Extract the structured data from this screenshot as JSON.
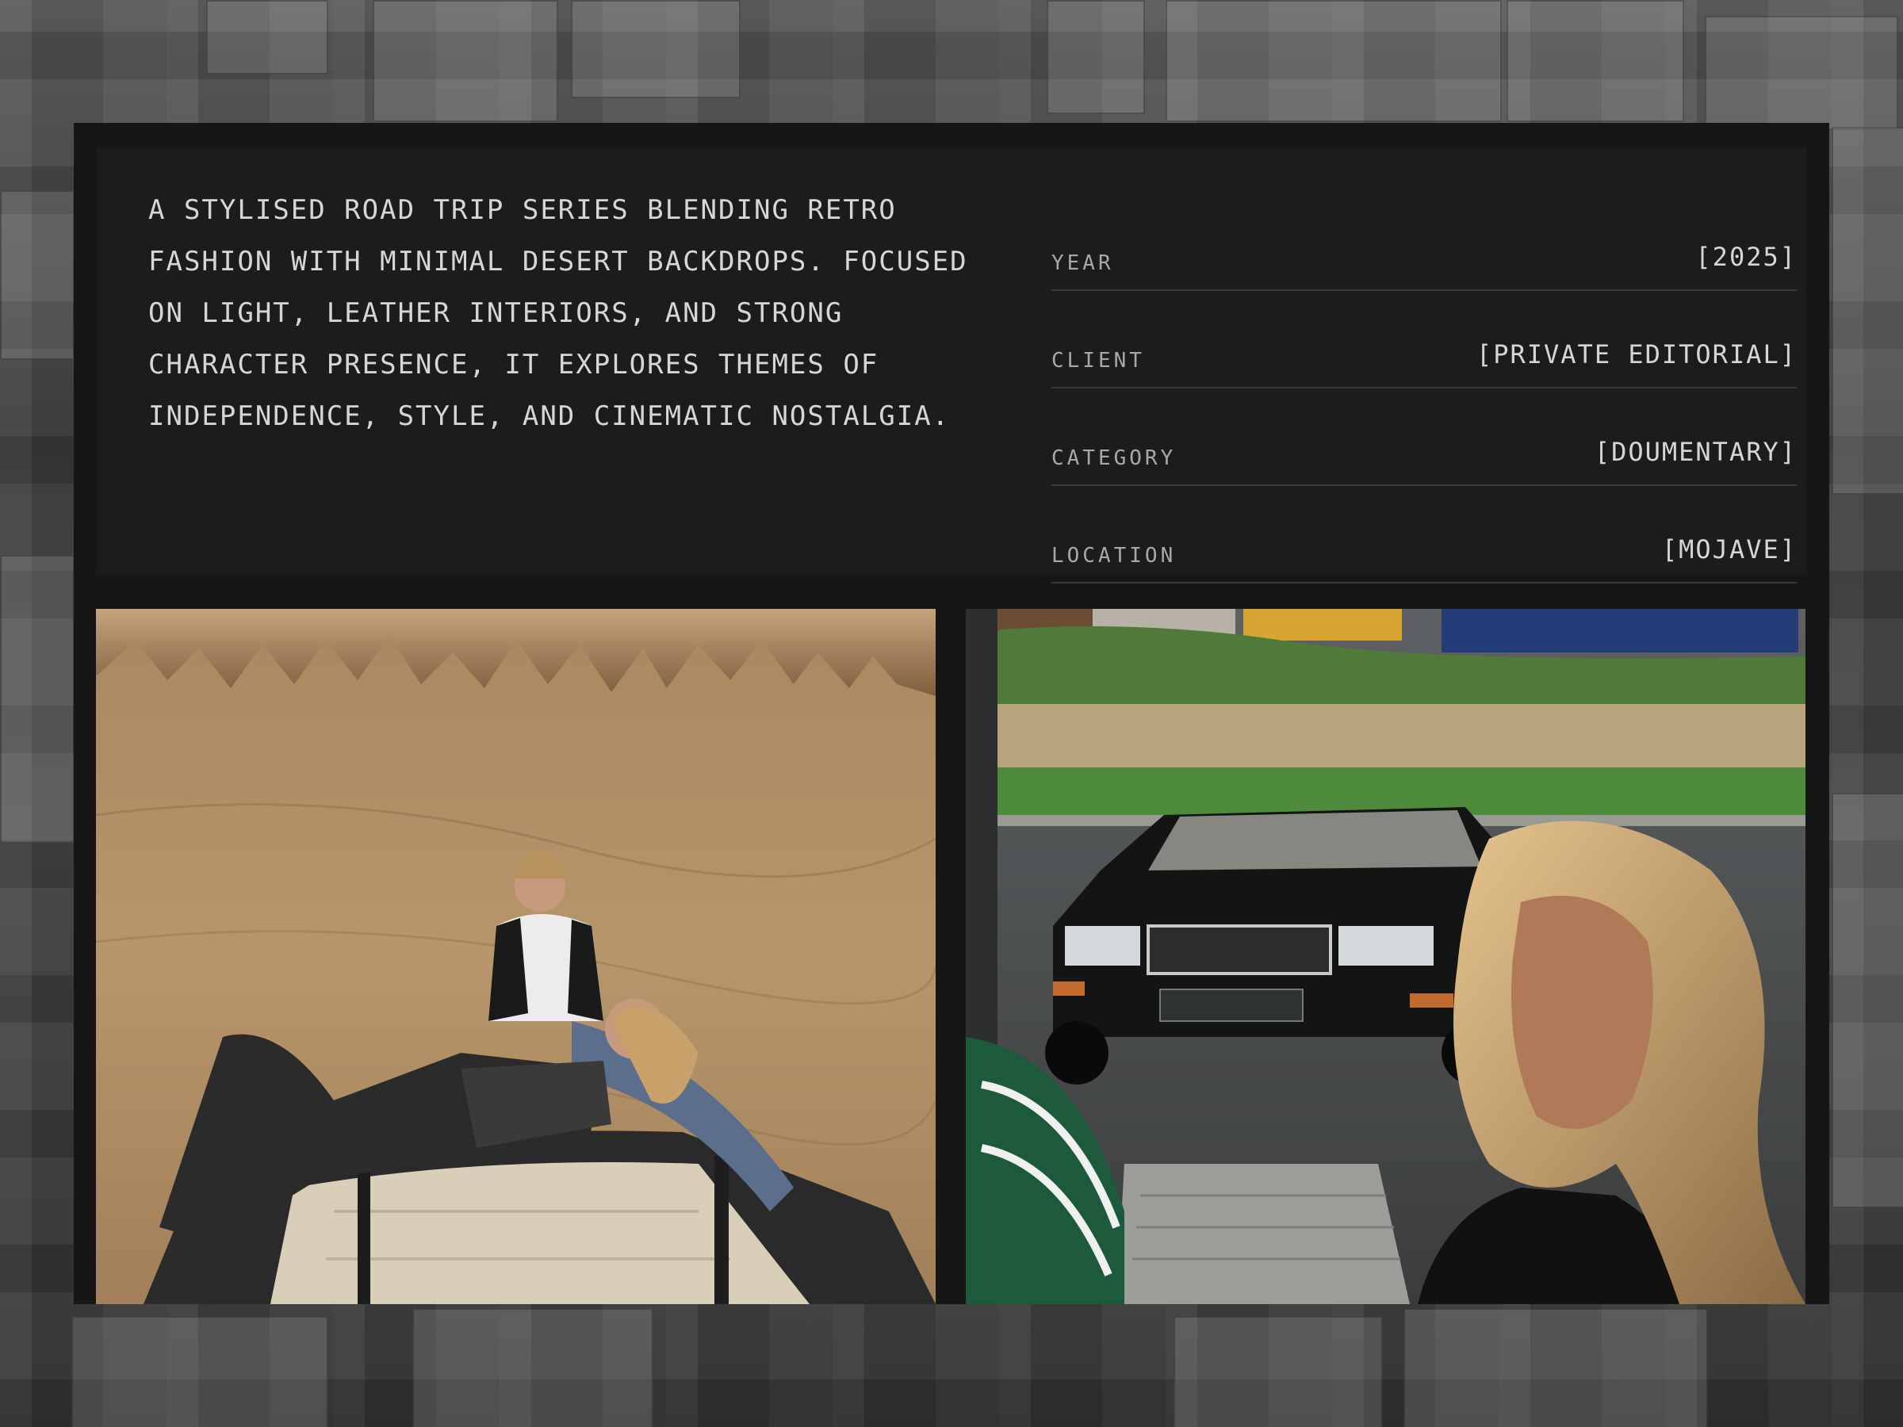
{
  "project": {
    "description": "A stylised road trip series blending retro fashion with minimal desert backdrops. Focused on light, leather interiors, and strong character presence, it explores themes of independence, style, and cinematic nostalgia.",
    "details": [
      {
        "label": "YEAR",
        "value": "[2025]"
      },
      {
        "label": "CLIENT",
        "value": "[PRIVATE EDITORIAL]"
      },
      {
        "label": "CATEGORY",
        "value": "[DOUMENTARY]"
      },
      {
        "label": "LOCATION",
        "value": "[MOJAVE]"
      }
    ]
  },
  "colors": {
    "panel": "#161616",
    "info_card": "#1c1c1c",
    "text": "#d6d6d6",
    "label": "#a8a8a8",
    "divider": "#3a3a3a"
  },
  "images": {
    "left": "desert-convertible-photo",
    "right": "convertible-street-portrait-photo"
  }
}
